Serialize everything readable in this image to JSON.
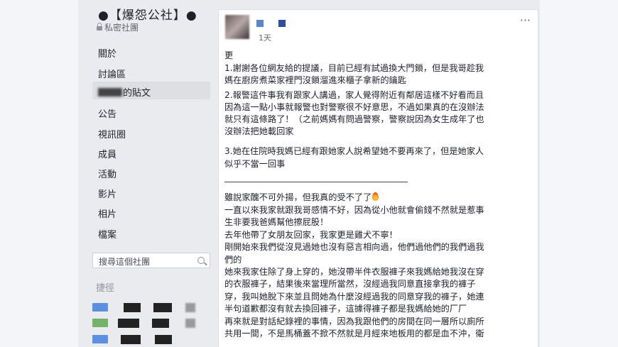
{
  "group": {
    "name": "●【爆怨公社】●",
    "privacy": "私密社團"
  },
  "nav": {
    "items": [
      "關於",
      "討論區",
      "的貼文",
      "公告",
      "視訊圈",
      "成員",
      "活動",
      "影片",
      "相片",
      "檔案"
    ],
    "search_placeholder": "搜尋這個社團",
    "shortcuts_label": "捷徑"
  },
  "post": {
    "time": "1天",
    "more": "···",
    "lines": [
      "更",
      "1.謝謝各位網友給的提議，目前已經有試過換大門鎖，但是我哥趁我",
      "媽在廚房煮菜家裡門沒鎖溜進來櫃子拿新的鑰匙",
      "2.報警這件事我有跟家人講過，家人覺得附近有鄰居這樣不好看而且",
      "因為這一點小事就報警也對警察很不好意思，不過如果真的在沒辦法",
      "就只有這條路了！（之前媽媽有問過警察，警察說因為女生成年了也",
      "沒辦法把她載回家",
      "3.她在住院時我媽已經有跟她家人說希望她不要再來了，但是她家人",
      "似乎不當一回事",
      "雖說家醜不可外揚，但我真的受不了了",
      "一直以來我家就跟我哥感情不好，因為從小他就會偷錢不然就是惹事",
      "生非要我爸媽幫他擦屁股！",
      "去年他帶了女朋友回家，我家更是雞犬不寧！",
      "剛開始來我們從沒見過她也沒有惡言相向過，他們過他們的我們過我",
      "們的",
      "她來我家住除了身上穿的，她沒帶半件衣服褲子來我媽給她我沒在穿",
      "的衣服褲子，結果後來當理所當然，沒經過我同意直接拿我的褲子",
      "穿，我叫她脫下來並且問她為什麼沒經過我的同意穿我的褲子，她連",
      "半句道歉都沒有就去換回褲子，這據得褲子都是我媽給她的厂厂",
      "再來就是對話紀錄裡的事情，因為我跟他們的房間在同一層所以廁所",
      "共用一間，不是馬桶蓋不掀不然就是月經來地板用的都是血不沖，衛"
    ]
  }
}
